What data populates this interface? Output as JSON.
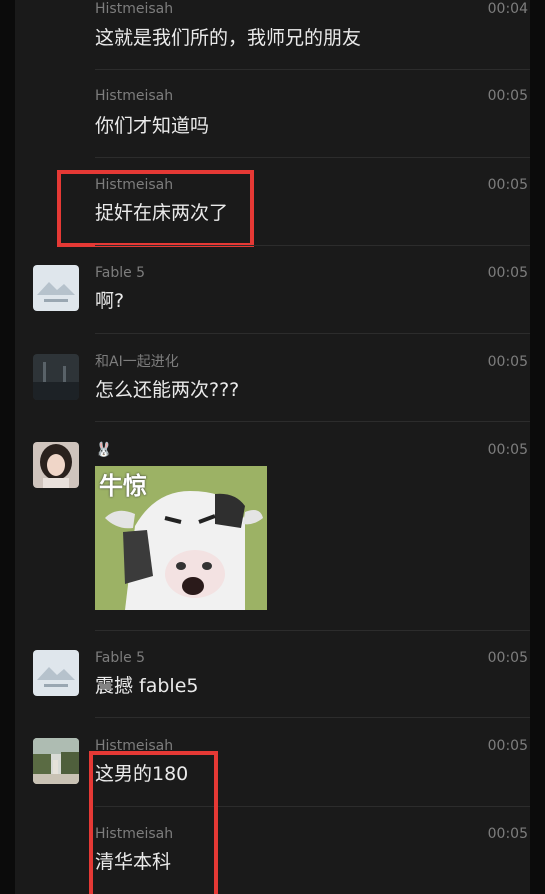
{
  "messages": [
    {
      "sender": "Histmeisah",
      "time": "00:04",
      "text": "这就是我们所的，我师兄的朋友"
    },
    {
      "sender": "Histmeisah",
      "time": "00:05",
      "text": "你们才知道吗"
    },
    {
      "sender": "Histmeisah",
      "time": "00:05",
      "text": "捉奸在床两次了"
    },
    {
      "sender": "Fable 5",
      "time": "00:05",
      "text": "啊?"
    },
    {
      "sender": "和AI一起进化",
      "time": "00:05",
      "text": "怎么还能两次???"
    },
    {
      "sender": "🐰",
      "time": "00:05",
      "sticker_caption": "牛惊"
    },
    {
      "sender": "Fable 5",
      "time": "00:05",
      "text": "震撼 fable5"
    },
    {
      "sender": "Histmeisah",
      "time": "00:05",
      "text": "这男的180"
    },
    {
      "sender": "Histmeisah",
      "time": "00:05",
      "text": "清华本科"
    }
  ],
  "colors": {
    "background": "#1a1a1a",
    "highlight_box": "#e53935",
    "text": "#eaeaea",
    "meta": "#7d7d7d"
  }
}
